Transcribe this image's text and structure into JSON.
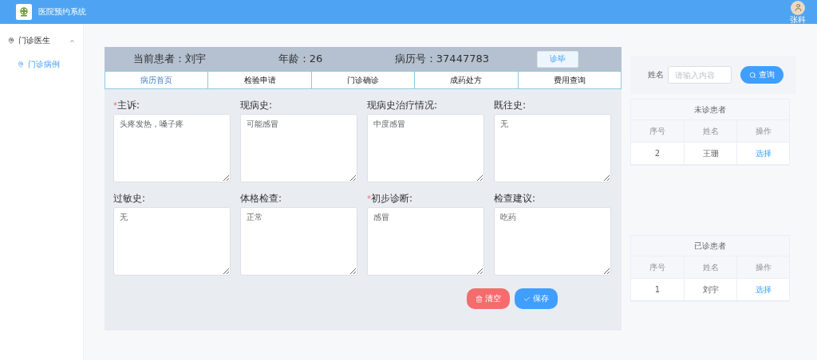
{
  "header": {
    "title": "医院预约系统",
    "user": "张科"
  },
  "sidebar": {
    "items": [
      {
        "label": "门诊医生",
        "expanded": true,
        "children": [
          {
            "label": "门诊病例",
            "selected": true
          }
        ]
      }
    ]
  },
  "patient": {
    "name": "当前患者：刘宇",
    "age": "年龄：26",
    "record": "病历号：37447783",
    "button": "诊毕"
  },
  "tabs": [
    {
      "label": "病历首页",
      "selected": true
    },
    {
      "label": "检验申请",
      "selected": false
    },
    {
      "label": "门诊确诊",
      "selected": false
    },
    {
      "label": "成药处方",
      "selected": false
    },
    {
      "label": "费用查询",
      "selected": false
    }
  ],
  "required_mark": "*",
  "fields": [
    {
      "label": "主诉:",
      "required": true,
      "value": "头疼发热，嗓子疼"
    },
    {
      "label": "现病史:",
      "required": false,
      "value": "可能感冒"
    },
    {
      "label": "现病史治疗情况:",
      "required": false,
      "value": "中度感冒"
    },
    {
      "label": "既往史:",
      "required": false,
      "value": "无"
    },
    {
      "label": "过敏史:",
      "required": false,
      "value": "无"
    },
    {
      "label": "体格检查:",
      "required": false,
      "value": "正常"
    },
    {
      "label": "初步诊断:",
      "required": true,
      "value": "感冒"
    },
    {
      "label": "检查建议:",
      "required": false,
      "value": "吃药"
    }
  ],
  "actions": [
    {
      "label": "清空",
      "kind": "danger"
    },
    {
      "label": "保存",
      "kind": "primary"
    }
  ],
  "search": {
    "label": "姓名",
    "placeholder": "请输入内容",
    "button": "查询"
  },
  "tables": [
    {
      "title": "未诊患者",
      "columns": [
        "序号",
        "姓名",
        "操作"
      ],
      "rows": [
        [
          "2",
          "王珊",
          "选择"
        ]
      ]
    },
    {
      "title": "已诊患者",
      "columns": [
        "序号",
        "姓名",
        "操作"
      ],
      "rows": [
        [
          "1",
          "刘宇",
          "选择"
        ]
      ]
    }
  ]
}
